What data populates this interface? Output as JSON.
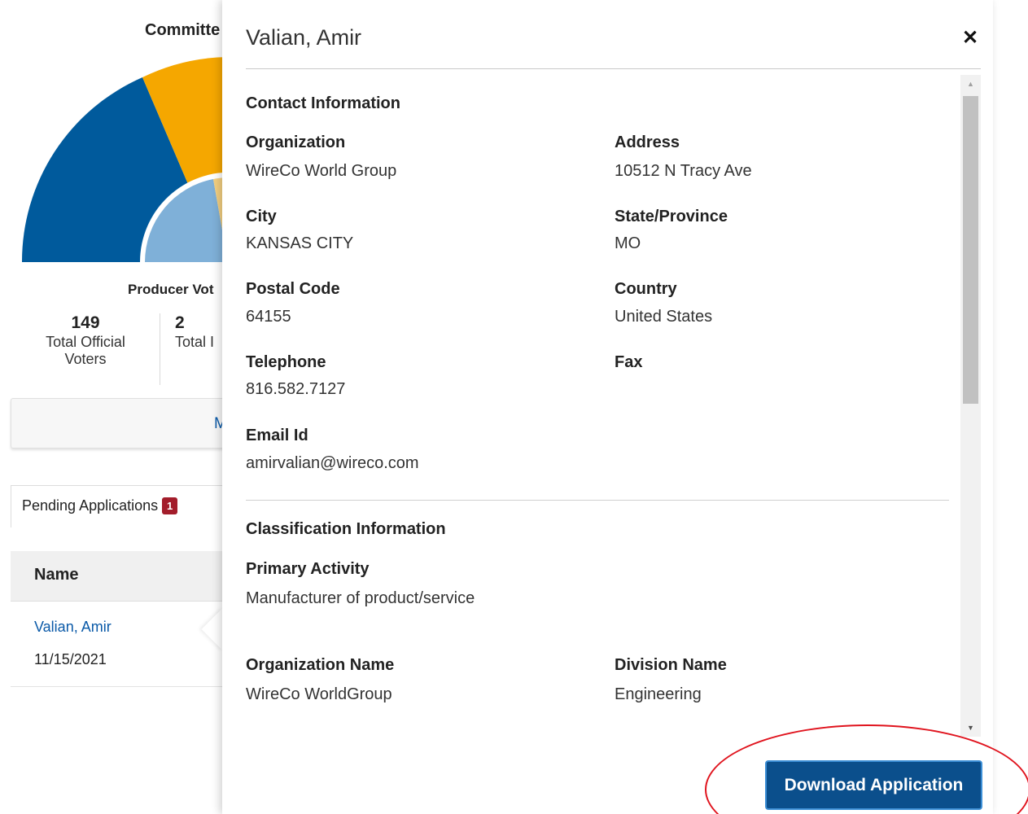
{
  "background": {
    "committee_title": "Committe",
    "chart_colors": {
      "dark_blue": "#005a9c",
      "orange": "#f5a700",
      "light_blue": "#7fb0d8",
      "light_orange": "#f3cf80"
    },
    "producer_votes_label": "Producer Vot",
    "stats": [
      {
        "number": "149",
        "label": "Total Official Voters"
      },
      {
        "number": "2",
        "label": "Total I"
      }
    ],
    "more_button_label": "M",
    "pending_tab": {
      "label": "Pending Applications",
      "count": "1"
    },
    "table": {
      "header": "Name",
      "rows": [
        {
          "name": "Valian, Amir",
          "date": "11/15/2021"
        }
      ]
    }
  },
  "panel": {
    "title": "Valian, Amir",
    "close_symbol": "✕",
    "contact_section": {
      "title": "Contact Information",
      "organization": {
        "label": "Organization",
        "value": "WireCo World Group"
      },
      "address": {
        "label": "Address",
        "value": "10512 N Tracy Ave"
      },
      "city": {
        "label": "City",
        "value": "KANSAS CITY"
      },
      "state": {
        "label": "State/Province",
        "value": "MO"
      },
      "postal_code": {
        "label": "Postal Code",
        "value": "64155"
      },
      "country": {
        "label": "Country",
        "value": "United States"
      },
      "telephone": {
        "label": "Telephone",
        "value": "816.582.7127"
      },
      "fax": {
        "label": "Fax",
        "value": ""
      },
      "email": {
        "label": "Email Id",
        "value": "amirvalian@wireco.com"
      }
    },
    "classification_section": {
      "title": "Classification Information",
      "primary_activity": {
        "label": "Primary Activity",
        "value": "Manufacturer of product/service"
      },
      "organization_name": {
        "label": "Organization Name",
        "value": "WireCo WorldGroup"
      },
      "division_name": {
        "label": "Division Name",
        "value": "Engineering"
      }
    },
    "download_button_label": "Download Application",
    "accent_color": "#0b4f8c",
    "annotation_color": "#e0141e"
  }
}
